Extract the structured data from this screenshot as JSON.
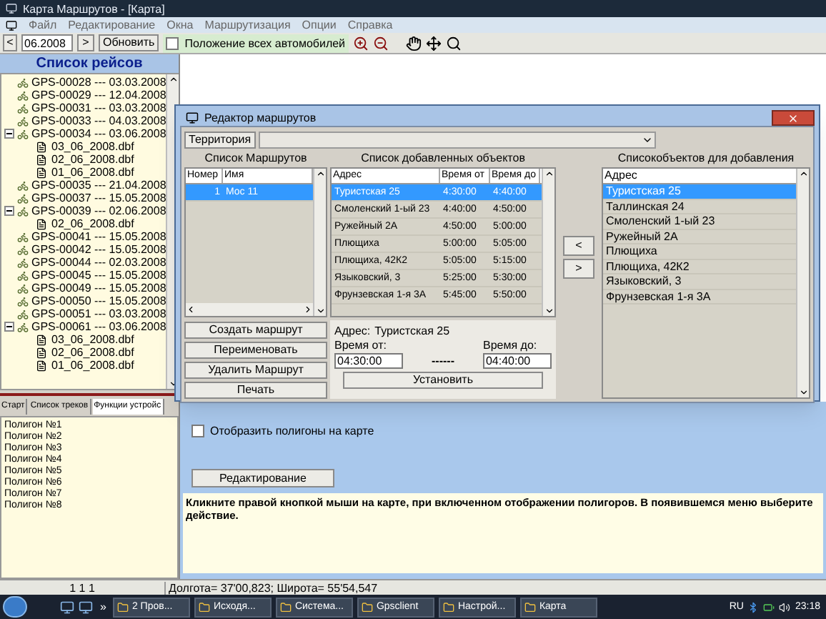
{
  "window": {
    "title": "Карта Маршрутов - [Карта]"
  },
  "menu": [
    "Файл",
    "Редактирование",
    "Окна",
    "Маршрутизация",
    "Опции",
    "Справка"
  ],
  "toolbar": {
    "prev": "<",
    "date": "06.2008",
    "next": ">",
    "refresh": "Обновить",
    "all_vehicles": {
      "label": "Положение всех автомобилей",
      "checked": false
    }
  },
  "trips": {
    "title": "Список рейсов",
    "items": [
      {
        "label": "GPS-00028 --- 03.03.2008"
      },
      {
        "label": "GPS-00029 --- 12.04.2008"
      },
      {
        "label": "GPS-00031 --- 03.03.2008"
      },
      {
        "label": "GPS-00033 --- 04.03.2008"
      },
      {
        "label": "GPS-00034 --- 03.06.2008",
        "expanded": true,
        "children": [
          {
            "label": "03_06_2008.dbf"
          },
          {
            "label": "02_06_2008.dbf"
          },
          {
            "label": "01_06_2008.dbf"
          }
        ]
      },
      {
        "label": "GPS-00035 --- 21.04.2008"
      },
      {
        "label": "GPS-00037 --- 15.05.2008"
      },
      {
        "label": "GPS-00039 --- 02.06.2008",
        "expanded": true,
        "children": [
          {
            "label": "02_06_2008.dbf"
          }
        ]
      },
      {
        "label": "GPS-00041 --- 15.05.2008"
      },
      {
        "label": "GPS-00042 --- 15.05.2008"
      },
      {
        "label": "GPS-00044 --- 02.03.2008"
      },
      {
        "label": "GPS-00045 --- 15.05.2008"
      },
      {
        "label": "GPS-00049 --- 15.05.2008"
      },
      {
        "label": "GPS-00050 --- 15.05.2008"
      },
      {
        "label": "GPS-00051 --- 03.03.2008"
      },
      {
        "label": "GPS-00061 --- 03.06.2008",
        "expanded": true,
        "children": [
          {
            "label": "03_06_2008.dbf"
          },
          {
            "label": "02_06_2008.dbf"
          },
          {
            "label": "01_06_2008.dbf"
          }
        ]
      }
    ]
  },
  "tabs": [
    {
      "label": "Старт",
      "selected": false
    },
    {
      "label": "Список треков",
      "selected": false
    },
    {
      "label": "Функции устройс",
      "selected": true
    }
  ],
  "polygons": [
    "Полигон №1",
    "Полигон №2",
    "Полигон №3",
    "Полигон №4",
    "Полигон №5",
    "Полигон №6",
    "Полигон №7",
    "Полигон №8"
  ],
  "polygon_panel": {
    "show_on_map": {
      "label": "Отобразить полигоны на карте",
      "checked": false
    },
    "edit_button": "Редактирование",
    "hint": "Кликните правой кнопкой мыши на карте, при включенном  отображении полигоров. В появившемся меню выберите действие."
  },
  "dialog": {
    "title": "Редактор маршрутов",
    "territory_button": "Территория",
    "routes": {
      "title": "Список Маршрутов",
      "columns": [
        "Номер",
        "Имя"
      ],
      "rows": [
        {
          "cells": [
            "1",
            "Мос 11"
          ],
          "selected": true
        }
      ]
    },
    "objects": {
      "title": "Список добавленных объектов",
      "columns": [
        "Адрес",
        "Время от",
        "Время до"
      ],
      "rows": [
        {
          "cells": [
            "Туристская 25",
            "4:30:00",
            "4:40:00"
          ],
          "selected": true
        },
        {
          "cells": [
            "Смоленский 1-ый 23",
            "4:40:00",
            "4:50:00"
          ],
          "selected": false
        },
        {
          "cells": [
            "Ружейный 2А",
            "4:50:00",
            "5:00:00"
          ],
          "selected": false
        },
        {
          "cells": [
            "Плющиха",
            "5:00:00",
            "5:05:00"
          ],
          "selected": false
        },
        {
          "cells": [
            "Плющиха, 42К2",
            "5:05:00",
            "5:15:00"
          ],
          "selected": false
        },
        {
          "cells": [
            "Языковский, 3",
            "5:25:00",
            "5:30:00"
          ],
          "selected": false
        },
        {
          "cells": [
            "Фрунзевская 1-я 3А",
            "5:45:00",
            "5:50:00"
          ],
          "selected": false
        }
      ]
    },
    "route_buttons": [
      "Создать маршрут",
      "Переименовать",
      "Удалить Маршрут",
      "Печать"
    ],
    "details": {
      "address_label": "Адрес:",
      "address": "Туристская 25",
      "from_label": "Время от:",
      "from": "04:30:00",
      "dashes": "------",
      "to_label": "Время до:",
      "to": "04:40:00",
      "set_button": "Установить"
    },
    "move_buttons": [
      "<",
      ">"
    ],
    "available": {
      "title": "Списокобъектов для добавления",
      "column": "Адрес",
      "rows": [
        {
          "label": "Туристская 25",
          "selected": true
        },
        {
          "label": "Таллинская 24",
          "selected": false
        },
        {
          "label": "Смоленский 1-ый 23",
          "selected": false
        },
        {
          "label": "Ружейный 2А",
          "selected": false
        },
        {
          "label": "Плющиха",
          "selected": false
        },
        {
          "label": "Плющиха, 42К2",
          "selected": false
        },
        {
          "label": "Языковский, 3",
          "selected": false
        },
        {
          "label": "Фрунзевская 1-я 3А",
          "selected": false
        }
      ]
    }
  },
  "status_bar": {
    "left": "1 1 1",
    "coords": "Долгота= 37'00,823; Широта= 55'54,547"
  },
  "taskbar": {
    "overflow": "»",
    "tasks": [
      "2 Пров...",
      "Исходя...",
      "Система...",
      "Gpsclient",
      "Настрой...",
      "Карта"
    ],
    "language": "RU",
    "time": "23:18"
  }
}
